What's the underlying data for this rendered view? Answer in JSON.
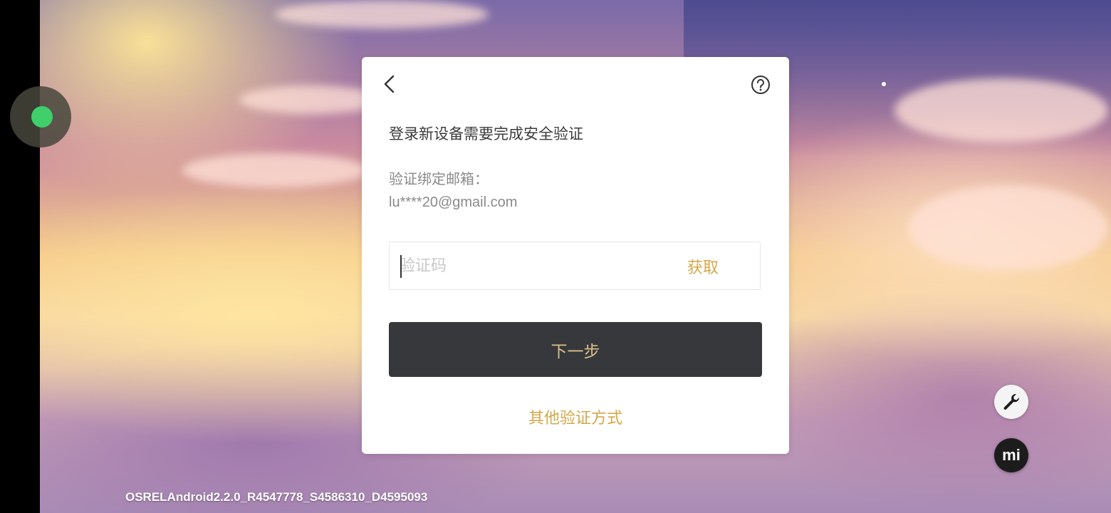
{
  "background": {
    "sky_color": "#7a6aa8",
    "sun_color": "#f4c98a"
  },
  "overlay": {
    "float_ball_color": "#3fcf6b"
  },
  "dialog": {
    "back_icon": "chevron-left-icon",
    "help_icon": "question-circle-icon",
    "title": "登录新设备需要完成安全验证",
    "bound_email_label": "验证绑定邮箱：",
    "bound_email_value": "lu****20@gmail.com",
    "code_input": {
      "placeholder": "验证码",
      "value": ""
    },
    "get_code_label": "获取",
    "next_button_label": "下一步",
    "other_methods_label": "其他验证方式",
    "accent_color": "#d4a74a",
    "button_color": "#36383b"
  },
  "tools": {
    "wrench_icon": "wrench-icon",
    "mi_label": "mi"
  },
  "version_text": "OSRELAndroid2.2.0_R4547778_S4586310_D4595093"
}
